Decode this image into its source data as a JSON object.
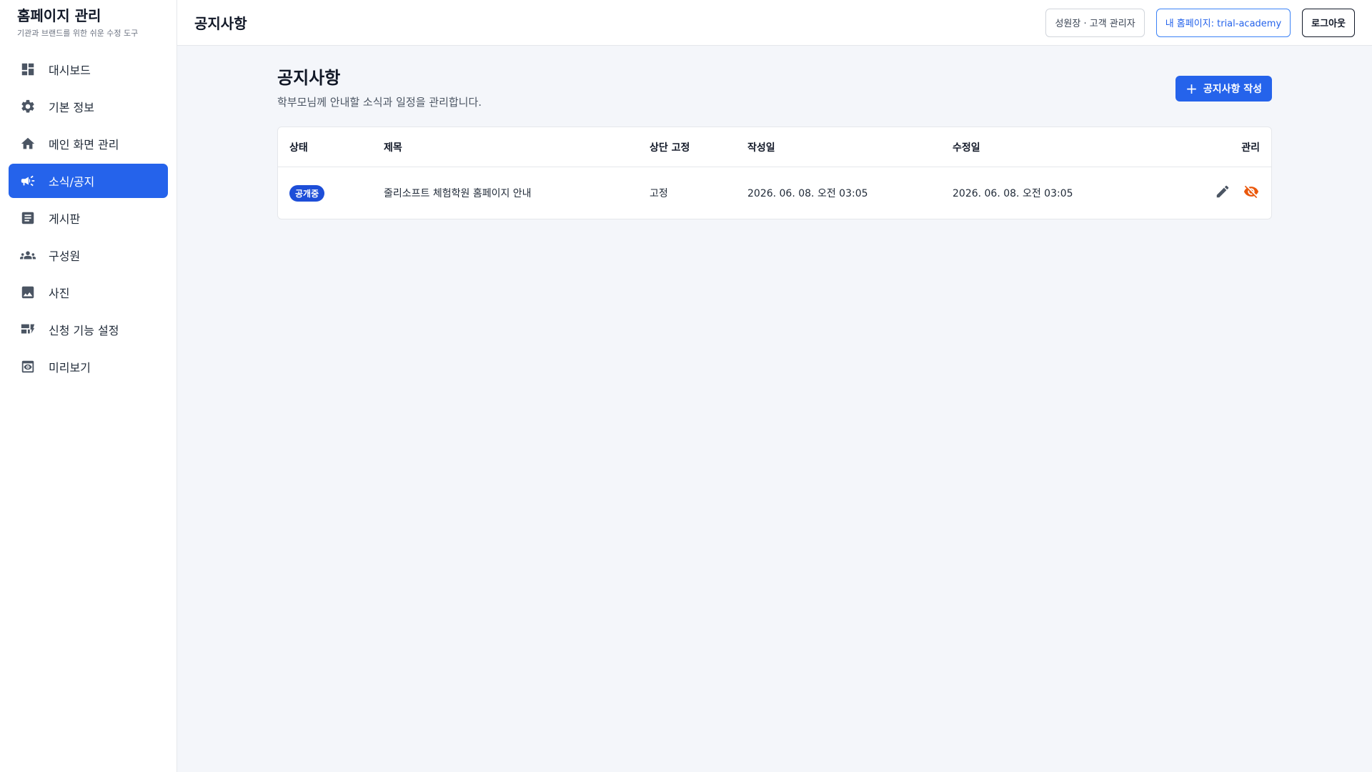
{
  "brand": {
    "title": "홈페이지 관리",
    "subtitle": "기관과 브랜드를 위한 쉬운 수정 도구"
  },
  "sidebar": {
    "items": [
      {
        "label": "대시보드",
        "icon": "dashboard-icon",
        "active": false
      },
      {
        "label": "기본 정보",
        "icon": "gear-icon",
        "active": false
      },
      {
        "label": "메인 화면 관리",
        "icon": "home-icon",
        "active": false
      },
      {
        "label": "소식/공지",
        "icon": "megaphone-icon",
        "active": true
      },
      {
        "label": "게시판",
        "icon": "article-icon",
        "active": false
      },
      {
        "label": "구성원",
        "icon": "group-icon",
        "active": false
      },
      {
        "label": "사진",
        "icon": "image-icon",
        "active": false
      },
      {
        "label": "신청 기능 설정",
        "icon": "form-icon",
        "active": false
      },
      {
        "label": "미리보기",
        "icon": "preview-icon",
        "active": false
      }
    ]
  },
  "header": {
    "title": "공지사항",
    "user_label": "성원장 · 고객 관리자",
    "site_label": "내 홈페이지: trial-academy",
    "logout_label": "로그아웃"
  },
  "main": {
    "title": "공지사항",
    "description": "학부모님께 안내할 소식과 일정을 관리합니다.",
    "create_button": "공지사항 작성",
    "table": {
      "columns": [
        "상태",
        "제목",
        "상단 고정",
        "작성일",
        "수정일",
        "관리"
      ],
      "rows": [
        {
          "status": "공개중",
          "title": "줄리소프트 체험학원 홈페이지 안내",
          "pinned": "고정",
          "created": "2026. 06. 08. 오전 03:05",
          "updated": "2026. 06. 08. 오전 03:05"
        }
      ]
    }
  },
  "colors": {
    "accent": "#2563eb",
    "badge": "#1d4ed8",
    "hide_icon": "#ea580c",
    "edit_icon": "#4b5563"
  }
}
